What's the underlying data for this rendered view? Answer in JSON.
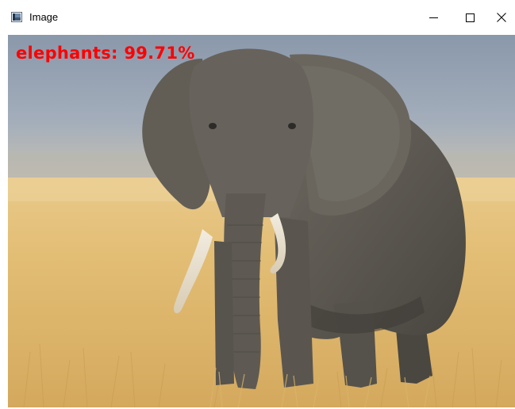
{
  "window": {
    "title": "Image",
    "icon": "image-window-icon",
    "controls": {
      "minimize_icon": "minimize-icon",
      "maximize_icon": "maximize-icon",
      "close_icon": "close-icon"
    }
  },
  "image": {
    "subject": "elephant",
    "detection_label": "elephants: 99.71%",
    "label_color": "#ff0000"
  }
}
